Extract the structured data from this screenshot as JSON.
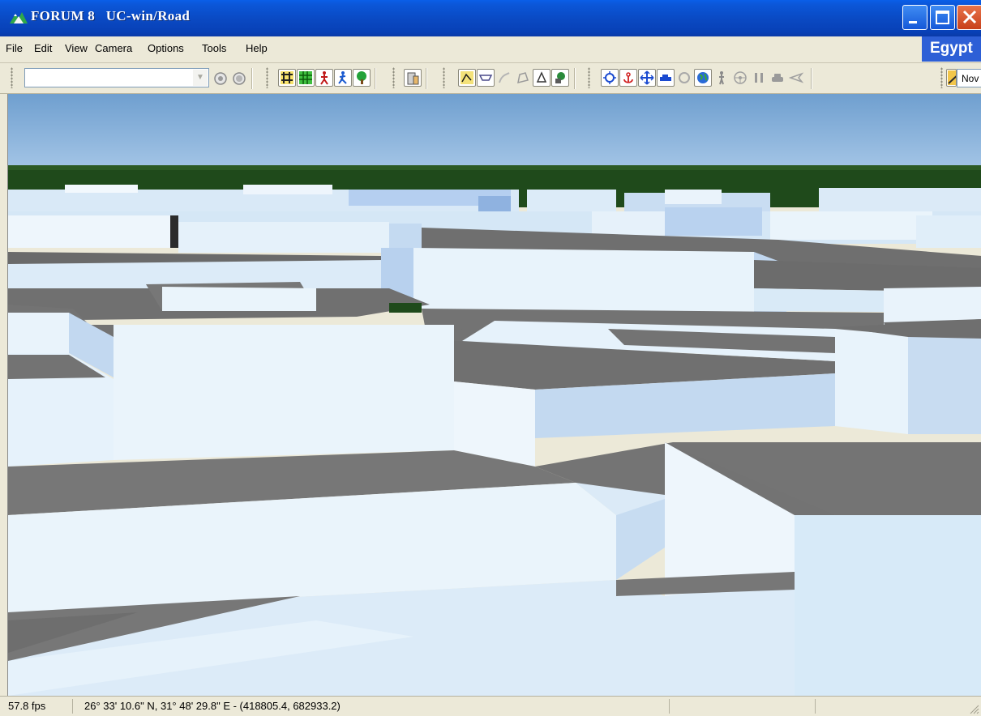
{
  "window": {
    "title": "FORUM 8   UC-win/Road",
    "logo_icon": "forum8-logo-icon",
    "titlebar_color": "#0a4ac4",
    "controls": [
      "minimize-icon",
      "maximize-icon",
      "close-icon"
    ]
  },
  "menu": {
    "items": [
      "File",
      "Edit",
      "View",
      "Camera",
      "Options",
      "Tools",
      "Help"
    ],
    "region_badge": "Egypt"
  },
  "toolbar": {
    "combo_value": "",
    "now_label": "Nov",
    "buttons": [
      "record-icon",
      "stop-icon",
      "road-network-icon",
      "terrain-icon",
      "pedestrian-icon",
      "walk-icon",
      "tree-icon",
      "building-icon",
      "map-icon",
      "cross-section-icon",
      "edit-curve-icon",
      "edit-shape-icon",
      "rotate-icon",
      "landscape-icon",
      "orbit-icon",
      "anchor-icon",
      "move-icon",
      "drive-icon",
      "fly-icon",
      "globe-icon",
      "person-icon",
      "steering-icon",
      "pause-icon",
      "car-icon",
      "plane-icon",
      "scenario-icon"
    ]
  },
  "scene": {
    "sky_color": "#7fa9d6",
    "tree_color": "#1e4d1a",
    "roof_color": "#777777",
    "wall_color": "#d7ecf8"
  },
  "status": {
    "fps": "57.8 fps",
    "coordinates": "26° 33' 10.6\" N, 31° 48' 29.8\" E  -  (418805.4, 682933.2)"
  }
}
